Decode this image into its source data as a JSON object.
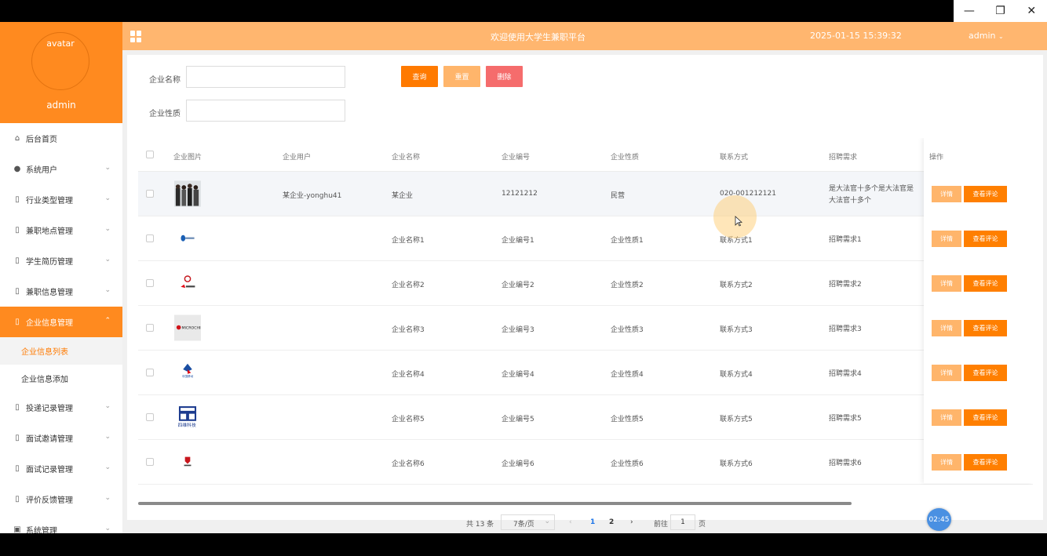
{
  "window": {
    "minimize": "—",
    "restore": "❐",
    "close": "✕"
  },
  "sidebar": {
    "avatar_text": "avatar",
    "username": "admin",
    "items": [
      {
        "label": "后台首页",
        "icon": "home-icon"
      },
      {
        "label": "系统用户",
        "icon": "user-icon"
      },
      {
        "label": "行业类型管理",
        "icon": "doc-icon"
      },
      {
        "label": "兼职地点管理",
        "icon": "doc-icon"
      },
      {
        "label": "学生简历管理",
        "icon": "doc-icon"
      },
      {
        "label": "兼职信息管理",
        "icon": "doc-icon"
      },
      {
        "label": "企业信息管理",
        "icon": "doc-icon",
        "active": true
      },
      {
        "label": "投递记录管理",
        "icon": "doc-icon"
      },
      {
        "label": "面试邀请管理",
        "icon": "doc-icon"
      },
      {
        "label": "面试记录管理",
        "icon": "doc-icon"
      },
      {
        "label": "评价反馈管理",
        "icon": "doc-icon"
      },
      {
        "label": "系统管理",
        "icon": "image-icon"
      }
    ],
    "subitems": [
      {
        "label": "企业信息列表",
        "active": true
      },
      {
        "label": "企业信息添加"
      }
    ]
  },
  "topbar": {
    "title": "欢迎使用大学生兼职平台",
    "datetime": "2025-01-15 15:39:32",
    "user": "admin"
  },
  "filters": {
    "name_label": "企业名称",
    "name_value": "",
    "nature_label": "企业性质",
    "nature_value": "",
    "search_btn": "查询",
    "reset_btn": "重置",
    "delete_btn": "删除"
  },
  "table": {
    "headers": [
      "企业图片",
      "企业用户",
      "企业名称",
      "企业编号",
      "企业性质",
      "联系方式",
      "招聘需求",
      "操作"
    ],
    "rows": [
      {
        "user": "某企业-yonghu41",
        "name": "某企业",
        "code": "12121212",
        "nature": "民营",
        "contact": "020-001212121",
        "demand_line1": "是大法官十多个是大法官是",
        "demand_line2": "大法官十多个",
        "logo": "photo"
      },
      {
        "user": "",
        "name": "企业名称1",
        "code": "企业编号1",
        "nature": "企业性质1",
        "contact": "联系方式1",
        "demand_line1": "招聘需求1",
        "demand_line2": "",
        "logo": "logo-1"
      },
      {
        "user": "",
        "name": "企业名称2",
        "code": "企业编号2",
        "nature": "企业性质2",
        "contact": "联系方式2",
        "demand_line1": "招聘需求2",
        "demand_line2": "",
        "logo": "logo-2"
      },
      {
        "user": "",
        "name": "企业名称3",
        "code": "企业编号3",
        "nature": "企业性质3",
        "contact": "联系方式3",
        "demand_line1": "招聘需求3",
        "demand_line2": "",
        "logo": "logo-3"
      },
      {
        "user": "",
        "name": "企业名称4",
        "code": "企业编号4",
        "nature": "企业性质4",
        "contact": "联系方式4",
        "demand_line1": "招聘需求4",
        "demand_line2": "",
        "logo": "logo-4"
      },
      {
        "user": "",
        "name": "企业名称5",
        "code": "企业编号5",
        "nature": "企业性质5",
        "contact": "联系方式5",
        "demand_line1": "招聘需求5",
        "demand_line2": "",
        "logo": "logo-5"
      },
      {
        "user": "",
        "name": "企业名称6",
        "code": "企业编号6",
        "nature": "企业性质6",
        "contact": "联系方式6",
        "demand_line1": "招聘需求6",
        "demand_line2": "",
        "logo": "logo-6"
      }
    ],
    "detail_btn": "详情",
    "comment_btn": "查看评论",
    "logo_texts": {
      "logo3": "MICROCHIP",
      "logo4": "中国移动",
      "logo5": "四维科技"
    }
  },
  "pager": {
    "total": "共 13 条",
    "size": "7条/页",
    "prev": "‹",
    "page1": "1",
    "page2": "2",
    "next": "›",
    "goto_label": "前往",
    "goto_value": "1",
    "page_suffix": "页"
  },
  "timer": "02:45",
  "colors": {
    "primary": "#ff8a1f",
    "topbar": "#ffb66f",
    "detail": "#ffb56b",
    "comment": "#ff7f00",
    "delete": "#f56c6c"
  }
}
